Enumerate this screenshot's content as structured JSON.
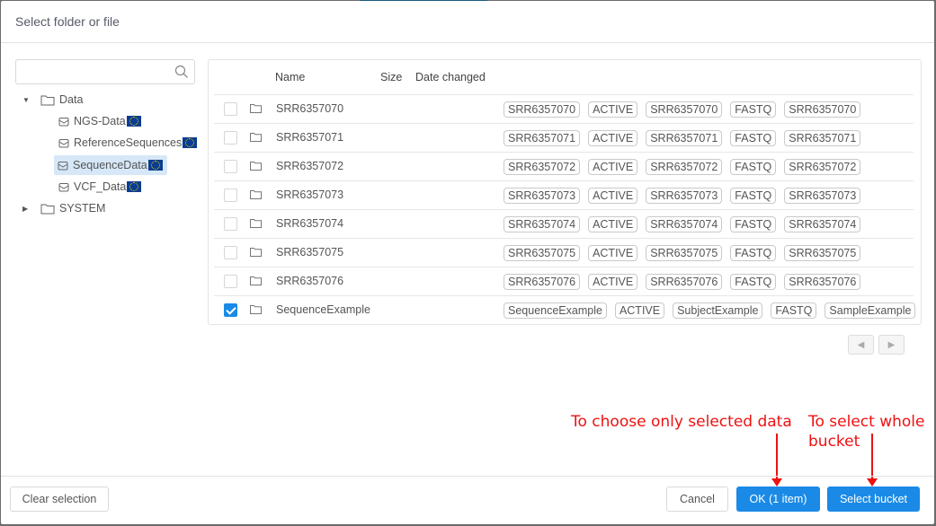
{
  "dialog": {
    "title": "Select folder or file"
  },
  "tree": {
    "search_placeholder": "",
    "search_value": "",
    "nodes": [
      {
        "label": "Data",
        "type": "folder",
        "expanded": true
      },
      {
        "label": "NGS-Data",
        "type": "bucket",
        "region_flag": "eu-flag"
      },
      {
        "label": "ReferenceSequences",
        "type": "bucket",
        "region_flag": "eu-flag"
      },
      {
        "label": "SequenceData",
        "type": "bucket",
        "region_flag": "eu-flag",
        "selected": true
      },
      {
        "label": "VCF_Data",
        "type": "bucket",
        "region_flag": "eu-flag"
      },
      {
        "label": "SYSTEM",
        "type": "folder",
        "expanded": false
      }
    ]
  },
  "table": {
    "columns": [
      "Name",
      "Size",
      "Date changed"
    ],
    "rows": [
      {
        "name": "SRR6357070",
        "checked": false,
        "tags": [
          "SRR6357070",
          "ACTIVE",
          "SRR6357070",
          "FASTQ",
          "SRR6357070"
        ]
      },
      {
        "name": "SRR6357071",
        "checked": false,
        "tags": [
          "SRR6357071",
          "ACTIVE",
          "SRR6357071",
          "FASTQ",
          "SRR6357071"
        ]
      },
      {
        "name": "SRR6357072",
        "checked": false,
        "tags": [
          "SRR6357072",
          "ACTIVE",
          "SRR6357072",
          "FASTQ",
          "SRR6357072"
        ]
      },
      {
        "name": "SRR6357073",
        "checked": false,
        "tags": [
          "SRR6357073",
          "ACTIVE",
          "SRR6357073",
          "FASTQ",
          "SRR6357073"
        ]
      },
      {
        "name": "SRR6357074",
        "checked": false,
        "tags": [
          "SRR6357074",
          "ACTIVE",
          "SRR6357074",
          "FASTQ",
          "SRR6357074"
        ]
      },
      {
        "name": "SRR6357075",
        "checked": false,
        "tags": [
          "SRR6357075",
          "ACTIVE",
          "SRR6357075",
          "FASTQ",
          "SRR6357075"
        ]
      },
      {
        "name": "SRR6357076",
        "checked": false,
        "tags": [
          "SRR6357076",
          "ACTIVE",
          "SRR6357076",
          "FASTQ",
          "SRR6357076"
        ]
      },
      {
        "name": "SequenceExample",
        "checked": true,
        "tags": [
          "SequenceExample",
          "ACTIVE",
          "SubjectExample",
          "FASTQ",
          "SampleExample"
        ]
      }
    ]
  },
  "pager": {
    "prev_icon": "chevron-left-icon",
    "next_icon": "chevron-right-icon"
  },
  "annotations": {
    "ok_note": "To choose only selected data",
    "bucket_note_line1": "To select whole",
    "bucket_note_line2": "bucket",
    "color": "#ee1111"
  },
  "footer": {
    "clear_label": "Clear selection",
    "cancel_label": "Cancel",
    "ok_label": "OK (1 item)",
    "select_bucket_label": "Select bucket"
  },
  "colors": {
    "primary": "#1a8ae6",
    "selected_node_bg": "#d6e8f8"
  }
}
